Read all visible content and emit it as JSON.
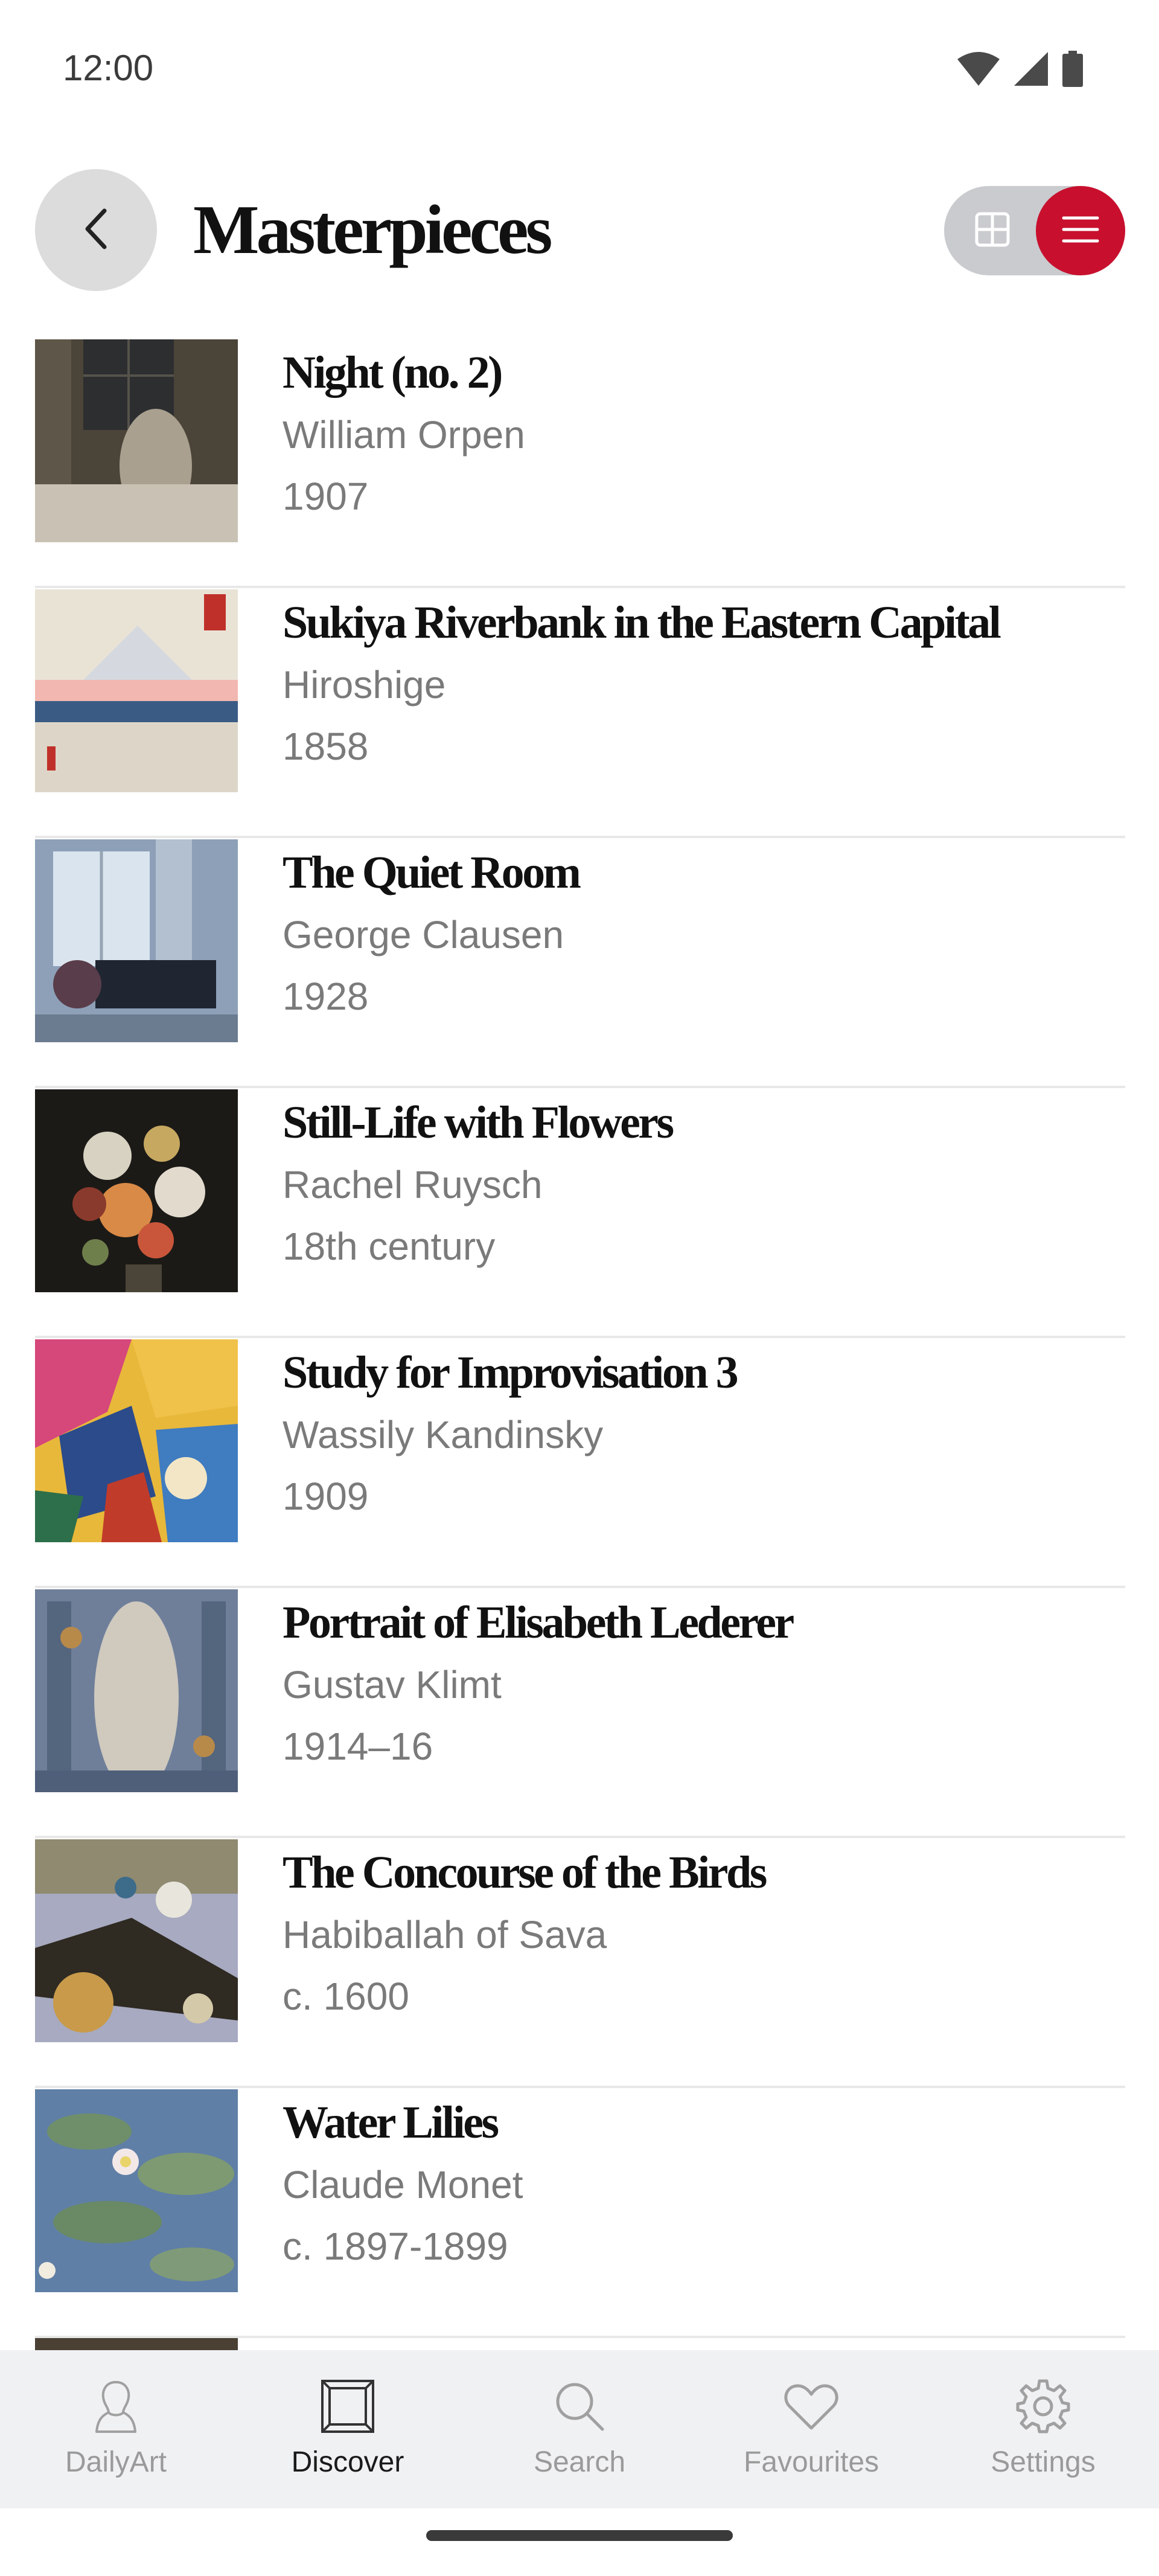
{
  "status": {
    "time": "12:00",
    "icons": [
      "wifi-icon",
      "cellular-signal-icon",
      "battery-icon"
    ]
  },
  "header": {
    "title": "Masterpieces",
    "back_icon": "chevron-left-icon",
    "view_toggle": {
      "options": [
        "grid",
        "list"
      ],
      "selected": "list"
    }
  },
  "colors": {
    "accent": "#c8102e",
    "muted_text": "#7a7a7a",
    "divider": "#e8e8e8"
  },
  "artworks": [
    {
      "title": "Night (no. 2)",
      "artist": "William Orpen",
      "date": "1907"
    },
    {
      "title": "Sukiya Riverbank in the Eastern Capital",
      "artist": "Hiroshige",
      "date": "1858"
    },
    {
      "title": "The Quiet Room",
      "artist": "George Clausen",
      "date": "1928"
    },
    {
      "title": "Still-Life with Flowers",
      "artist": "Rachel Ruysch",
      "date": "18th century"
    },
    {
      "title": "Study for Improvisation 3",
      "artist": "Wassily Kandinsky",
      "date": "1909"
    },
    {
      "title": "Portrait of Elisabeth Lederer",
      "artist": "Gustav Klimt",
      "date": "1914–16"
    },
    {
      "title": "The Concourse of the Birds",
      "artist": "Habiballah of Sava",
      "date": "c. 1600"
    },
    {
      "title": "Water Lilies",
      "artist": "Claude Monet",
      "date": "c. 1897-1899"
    }
  ],
  "nav": {
    "items": [
      {
        "label": "DailyArt",
        "icon": "dailyart-bust-icon",
        "active": false
      },
      {
        "label": "Discover",
        "icon": "frame-icon",
        "active": true
      },
      {
        "label": "Search",
        "icon": "search-icon",
        "active": false
      },
      {
        "label": "Favourites",
        "icon": "heart-icon",
        "active": false
      },
      {
        "label": "Settings",
        "icon": "gear-icon",
        "active": false
      }
    ]
  }
}
